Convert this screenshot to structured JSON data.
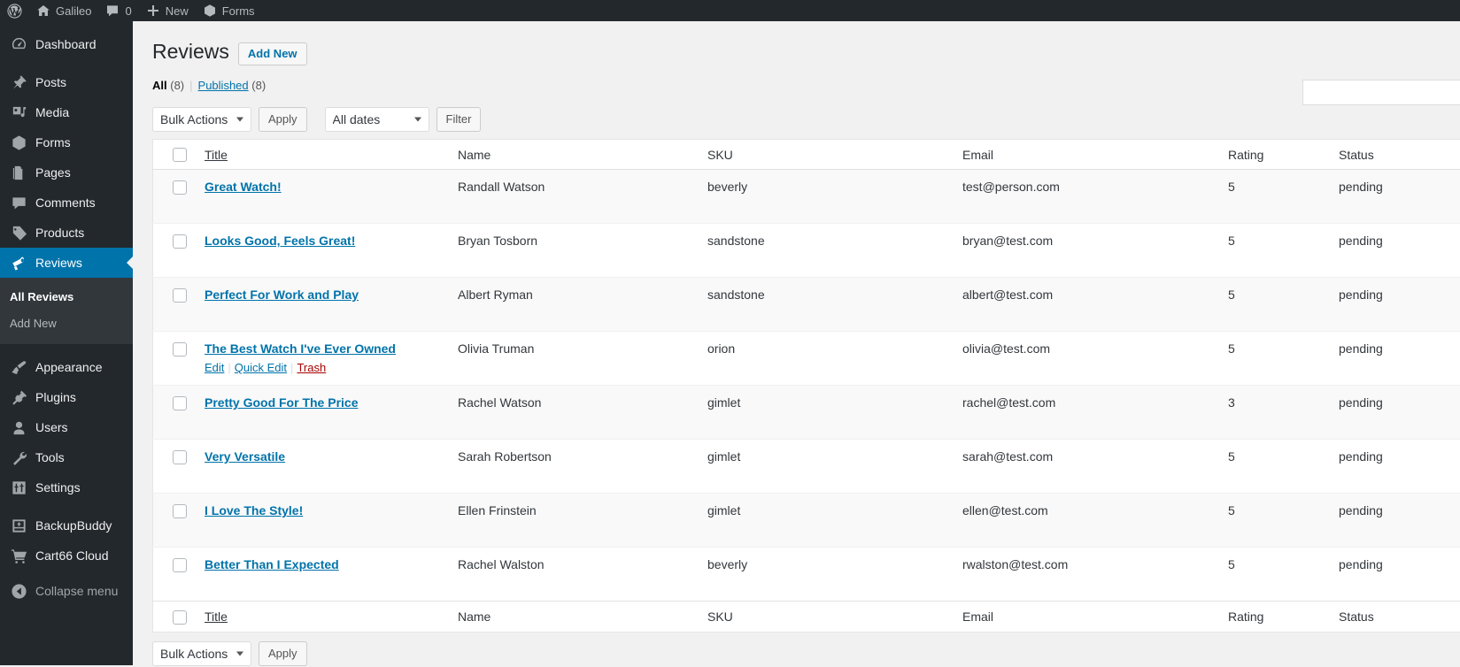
{
  "adminbar": {
    "items": [
      {
        "icon": "wordpress-logo-icon",
        "label": ""
      },
      {
        "icon": "home-icon",
        "label": "Galileo"
      },
      {
        "icon": "comment-bubble-icon",
        "label": "0"
      },
      {
        "icon": "plus-icon",
        "label": "New"
      },
      {
        "icon": "forms-icon",
        "label": "Forms"
      }
    ]
  },
  "sidebar": {
    "items": [
      {
        "icon": "dashboard-icon",
        "label": "Dashboard"
      },
      {
        "icon": "posts-pin-icon",
        "label": "Posts"
      },
      {
        "icon": "media-icon",
        "label": "Media"
      },
      {
        "icon": "forms-icon",
        "label": "Forms"
      },
      {
        "icon": "pages-icon",
        "label": "Pages"
      },
      {
        "icon": "comments-icon",
        "label": "Comments"
      },
      {
        "icon": "products-tag-icon",
        "label": "Products"
      },
      {
        "icon": "reviews-megaphone-icon",
        "label": "Reviews",
        "current": true
      },
      {
        "icon": "appearance-brush-icon",
        "label": "Appearance"
      },
      {
        "icon": "plugins-plug-icon",
        "label": "Plugins"
      },
      {
        "icon": "users-icon",
        "label": "Users"
      },
      {
        "icon": "tools-wrench-icon",
        "label": "Tools"
      },
      {
        "icon": "settings-sliders-icon",
        "label": "Settings"
      },
      {
        "icon": "backupbuddy-icon",
        "label": "BackupBuddy"
      },
      {
        "icon": "cart-icon",
        "label": "Cart66 Cloud"
      }
    ],
    "submenu": [
      {
        "label": "All Reviews",
        "current": true
      },
      {
        "label": "Add New",
        "current": false
      }
    ],
    "collapse": {
      "icon": "collapse-arrow-icon",
      "label": "Collapse menu"
    },
    "current_color": "#0073aa"
  },
  "page": {
    "title": "Reviews",
    "add_new_label": "Add New"
  },
  "views": {
    "all_label": "All",
    "all_count": "(8)",
    "separator": "|",
    "published_label": "Published",
    "published_count": "(8)"
  },
  "search": {
    "value": "",
    "placeholder": ""
  },
  "tablenav_top": {
    "bulk_actions_label": "Bulk Actions",
    "apply_label": "Apply",
    "dates_label": "All dates",
    "filter_label": "Filter"
  },
  "tablenav_bottom": {
    "bulk_actions_label": "Bulk Actions",
    "apply_label": "Apply"
  },
  "table": {
    "columns": {
      "title": "Title",
      "name": "Name",
      "sku": "SKU",
      "email": "Email",
      "rating": "Rating",
      "status": "Status"
    },
    "row_actions": {
      "edit": "Edit",
      "quick_edit": "Quick Edit",
      "trash": "Trash",
      "separator": "|"
    },
    "rows": [
      {
        "title": "Great Watch!",
        "name": "Randall Watson",
        "sku": "beverly",
        "email": "test@person.com",
        "rating": "5",
        "status": "pending"
      },
      {
        "title": "Looks Good, Feels Great!",
        "name": "Bryan Tosborn",
        "sku": "sandstone",
        "email": "bryan@test.com",
        "rating": "5",
        "status": "pending"
      },
      {
        "title": "Perfect For Work and Play",
        "name": "Albert Ryman",
        "sku": "sandstone",
        "email": "albert@test.com",
        "rating": "5",
        "status": "pending"
      },
      {
        "title": "The Best Watch I've Ever Owned",
        "name": "Olivia Truman",
        "sku": "orion",
        "email": "olivia@test.com",
        "rating": "5",
        "status": "pending",
        "hovered": true
      },
      {
        "title": "Pretty Good For The Price",
        "name": "Rachel Watson",
        "sku": "gimlet",
        "email": "rachel@test.com",
        "rating": "3",
        "status": "pending"
      },
      {
        "title": "Very Versatile",
        "name": "Sarah Robertson",
        "sku": "gimlet",
        "email": "sarah@test.com",
        "rating": "5",
        "status": "pending"
      },
      {
        "title": "I Love The Style!",
        "name": "Ellen Frinstein",
        "sku": "gimlet",
        "email": "ellen@test.com",
        "rating": "5",
        "status": "pending"
      },
      {
        "title": "Better Than I Expected",
        "name": "Rachel Walston",
        "sku": "beverly",
        "email": "rwalston@test.com",
        "rating": "5",
        "status": "pending"
      }
    ]
  },
  "colors": {
    "sidebar_bg": "#23282d",
    "submenu_bg": "#32373c",
    "accent": "#0073aa",
    "link": "#0073aa",
    "trash": "#a00",
    "page_bg": "#f1f1f1"
  }
}
